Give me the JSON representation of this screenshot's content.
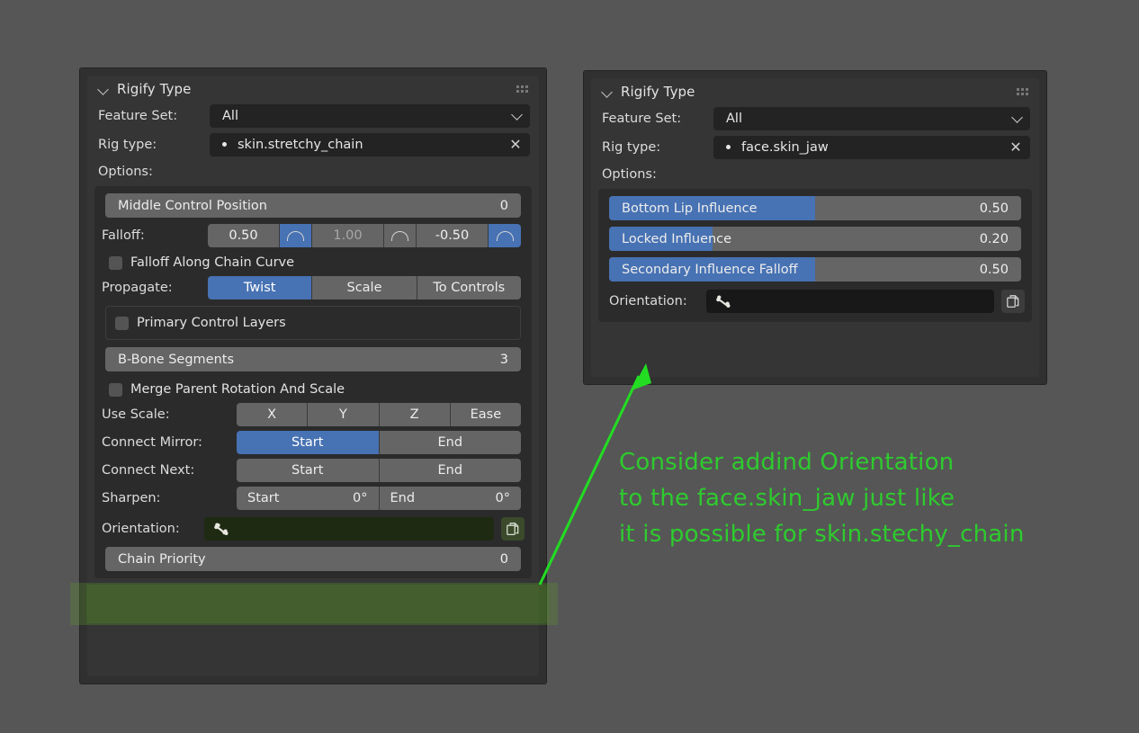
{
  "left_panel": {
    "header": {
      "title": "Rigify Type",
      "collapse_icon": "chevron-down-icon",
      "grip_icon": "grip-dots-icon"
    },
    "feature_set": {
      "label": "Feature Set:",
      "value": "All",
      "dropdown_icon": "chevron-down-icon"
    },
    "rig_type": {
      "label": "Rig type:",
      "value": "skin.stretchy_chain",
      "clear_icon": "close-icon",
      "bullet_icon": "dot-icon"
    },
    "options_label": "Options:",
    "middle_control_position": {
      "label": "Middle Control Position",
      "value": "0"
    },
    "falloff": {
      "label": "Falloff:",
      "values": [
        "0.50",
        "1.00",
        "-0.50"
      ],
      "curve_icons": [
        "arc-icon",
        "arc-icon",
        "arc-icon"
      ],
      "curve_active": [
        true,
        false,
        true
      ]
    },
    "falloff_along_chain_curve": {
      "label": "Falloff Along Chain Curve",
      "checked": false
    },
    "propagate": {
      "label": "Propagate:",
      "options": [
        "Twist",
        "Scale",
        "To Controls"
      ],
      "selected": "Twist"
    },
    "primary_control_layers": {
      "label": "Primary Control Layers",
      "checked": false
    },
    "bbone_segments": {
      "label": "B-Bone Segments",
      "value": "3"
    },
    "merge_parent_rotation": {
      "label": "Merge Parent Rotation And Scale",
      "checked": false
    },
    "use_scale": {
      "label": "Use Scale:",
      "options": [
        "X",
        "Y",
        "Z",
        "Ease"
      ],
      "selected": ""
    },
    "connect_mirror": {
      "label": "Connect Mirror:",
      "options": [
        "Start",
        "End"
      ],
      "selected": "Start"
    },
    "connect_next": {
      "label": "Connect Next:",
      "options": [
        "Start",
        "End"
      ],
      "selected": ""
    },
    "sharpen": {
      "label": "Sharpen:",
      "start_label": "Start",
      "start_value": "0°",
      "end_label": "End",
      "end_value": "0°"
    },
    "orientation": {
      "label": "Orientation:",
      "value": "",
      "bone_icon": "bone-icon",
      "copy_icon": "copy-icon"
    },
    "chain_priority": {
      "label": "Chain Priority",
      "value": "0"
    }
  },
  "right_panel": {
    "header": {
      "title": "Rigify Type",
      "collapse_icon": "chevron-down-icon",
      "grip_icon": "grip-dots-icon"
    },
    "feature_set": {
      "label": "Feature Set:",
      "value": "All",
      "dropdown_icon": "chevron-down-icon"
    },
    "rig_type": {
      "label": "Rig type:",
      "value": "face.skin_jaw",
      "clear_icon": "close-icon",
      "bullet_icon": "dot-icon"
    },
    "options_label": "Options:",
    "sliders": [
      {
        "label": "Bottom Lip Influence",
        "value": "0.50",
        "fill_percent": 50
      },
      {
        "label": "Locked Influence",
        "value": "0.20",
        "fill_percent": 20
      },
      {
        "label": "Secondary Influence Falloff",
        "value": "0.50",
        "fill_percent": 50
      }
    ],
    "orientation": {
      "label": "Orientation:",
      "value": "",
      "bone_icon": "bone-icon",
      "copy_icon": "copy-icon"
    }
  },
  "annotation": {
    "text": "Consider addind Orientation\nto the face.skin_jaw just like\nit is possible for skin.stechy_chain",
    "color": "#2ecb2e",
    "arrow_icon": "arrow-pointer-icon"
  },
  "colors": {
    "background": "#565656",
    "panel": "#303030",
    "panel_inner": "#353535",
    "option_box": "#2b2b2b",
    "widget": "#656565",
    "accent_blue": "#4772b3",
    "field_dark": "#232323",
    "annotation_green": "#2ecb2e",
    "highlight_green": "#3c5a1e"
  }
}
